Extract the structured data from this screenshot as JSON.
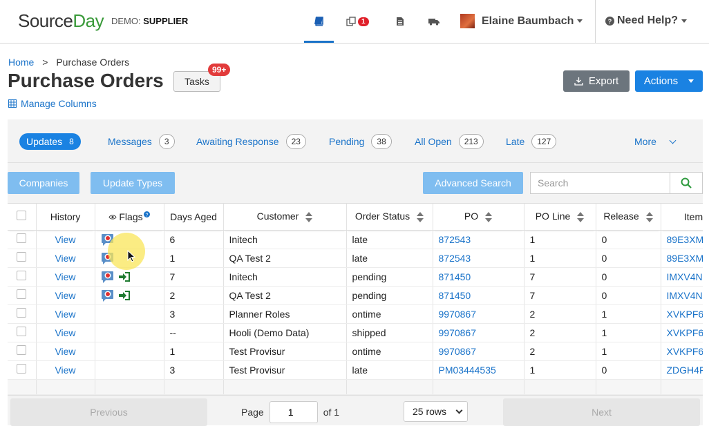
{
  "brand": {
    "logo_part1": "Source",
    "logo_part2": "Day",
    "demo_prefix": "DEMO: ",
    "demo_value": "SUPPLIER"
  },
  "nav": {
    "notifications_count": "1",
    "user_name": "Elaine Baumbach",
    "help_label": "Need Help?"
  },
  "breadcrumb": {
    "home": "Home",
    "separator": ">",
    "current": "Purchase Orders"
  },
  "page": {
    "title": "Purchase Orders",
    "tasks_label": "Tasks",
    "tasks_badge": "99+",
    "manage_columns": "Manage Columns",
    "export_label": "Export",
    "actions_label": "Actions"
  },
  "tabs": [
    {
      "label": "Updates",
      "count": "8"
    },
    {
      "label": "Messages",
      "count": "3"
    },
    {
      "label": "Awaiting Response",
      "count": "23"
    },
    {
      "label": "Pending",
      "count": "38"
    },
    {
      "label": "All Open",
      "count": "213"
    },
    {
      "label": "Late",
      "count": "127"
    }
  ],
  "more_label": "More",
  "filters": {
    "companies": "Companies",
    "update_types": "Update Types",
    "advanced_search": "Advanced Search",
    "search_placeholder": "Search"
  },
  "columns": {
    "history": "History",
    "flags": "Flags",
    "days_aged": "Days Aged",
    "customer": "Customer",
    "order_status": "Order Status",
    "po": "PO",
    "po_line": "PO Line",
    "release": "Release",
    "item": "Item"
  },
  "rows": [
    {
      "history": "View",
      "days": "6",
      "customer": "Initech",
      "status": "late",
      "po": "872543",
      "line": "1",
      "release": "0",
      "item": "89E3XM"
    },
    {
      "history": "View",
      "days": "1",
      "customer": "QA Test 2",
      "status": "late",
      "po": "872543",
      "line": "1",
      "release": "0",
      "item": "89E3XM"
    },
    {
      "history": "View",
      "days": "7",
      "customer": "Initech",
      "status": "pending",
      "po": "871450",
      "line": "7",
      "release": "0",
      "item": "IMXV4N"
    },
    {
      "history": "View",
      "days": "2",
      "customer": "QA Test 2",
      "status": "pending",
      "po": "871450",
      "line": "7",
      "release": "0",
      "item": "IMXV4N"
    },
    {
      "history": "View",
      "days": "3",
      "customer": "Planner Roles",
      "status": "ontime",
      "po": "9970867",
      "line": "2",
      "release": "1",
      "item": "XVKPF6"
    },
    {
      "history": "View",
      "days": "--",
      "customer": "Hooli (Demo Data)",
      "status": "shipped",
      "po": "9970867",
      "line": "2",
      "release": "1",
      "item": "XVKPF6"
    },
    {
      "history": "View",
      "days": "1",
      "customer": "Test Provisur",
      "status": "ontime",
      "po": "9970867",
      "line": "2",
      "release": "1",
      "item": "XVKPF6"
    },
    {
      "history": "View",
      "days": "3",
      "customer": "Test Provisur",
      "status": "late",
      "po": "PM03444535",
      "line": "1",
      "release": "0",
      "item": "ZDGH4F"
    }
  ],
  "pagination": {
    "previous": "Previous",
    "page_label": "Page",
    "page_value": "1",
    "of_label": "of 1",
    "rows_option": "25 rows",
    "next": "Next"
  }
}
